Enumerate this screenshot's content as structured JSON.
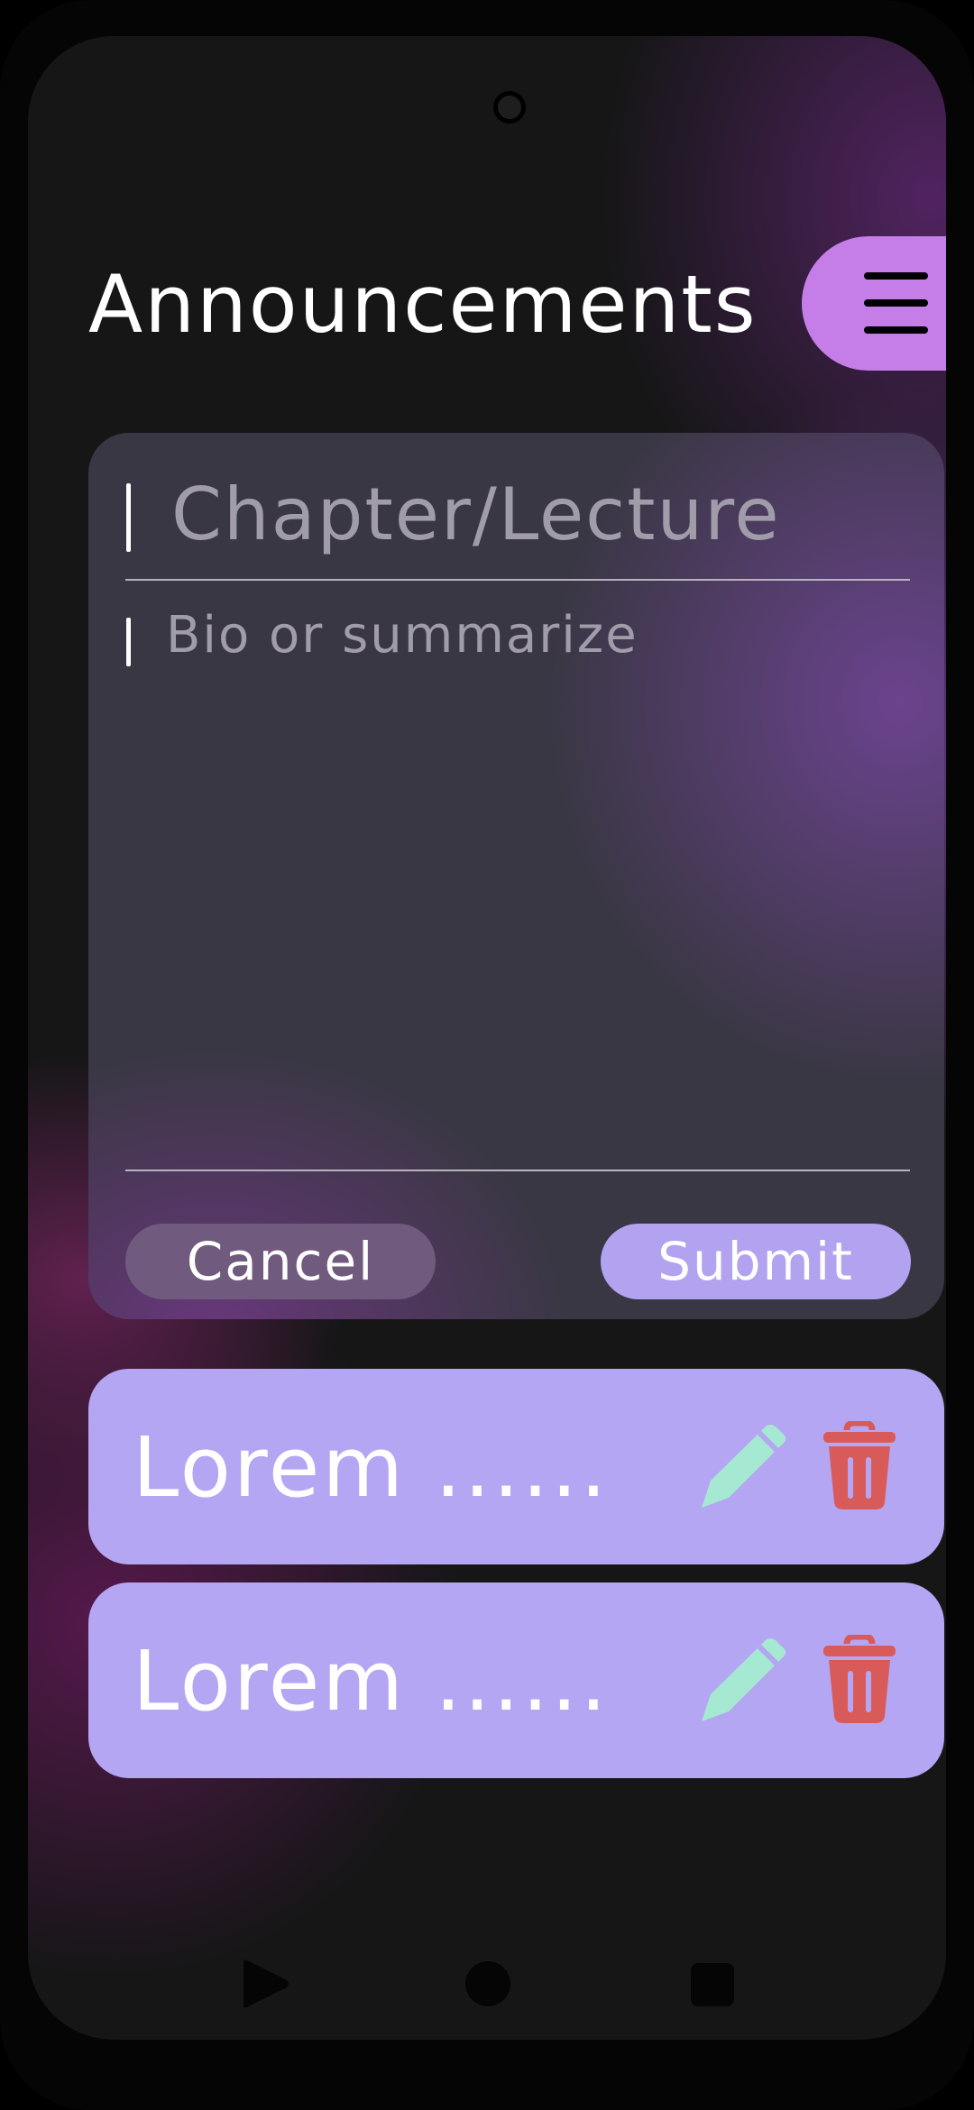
{
  "header": {
    "title": "Announcements",
    "menu_icon": "hamburger-menu-icon"
  },
  "form": {
    "title_placeholder": "Chapter/Lecture",
    "title_value": "",
    "summary_placeholder": "Bio or summarize",
    "summary_value": "",
    "cancel_label": "Cancel",
    "submit_label": "Submit"
  },
  "items": [
    {
      "text": "Lorem ......",
      "edit_icon": "pencil-icon",
      "delete_icon": "trash-icon"
    },
    {
      "text": "Lorem ......",
      "edit_icon": "pencil-icon",
      "delete_icon": "trash-icon"
    }
  ],
  "nav": {
    "back_icon": "triangle-back-icon",
    "home_icon": "circle-home-icon",
    "recent_icon": "square-recents-icon"
  },
  "colors": {
    "accent_menu": "#c57ee8",
    "item_background": "#b5a6f4",
    "submit_button": "#b3a2f0",
    "cancel_button": "#705a7e",
    "edit_icon": "#a6e9d2",
    "delete_icon": "#d85b5a"
  }
}
